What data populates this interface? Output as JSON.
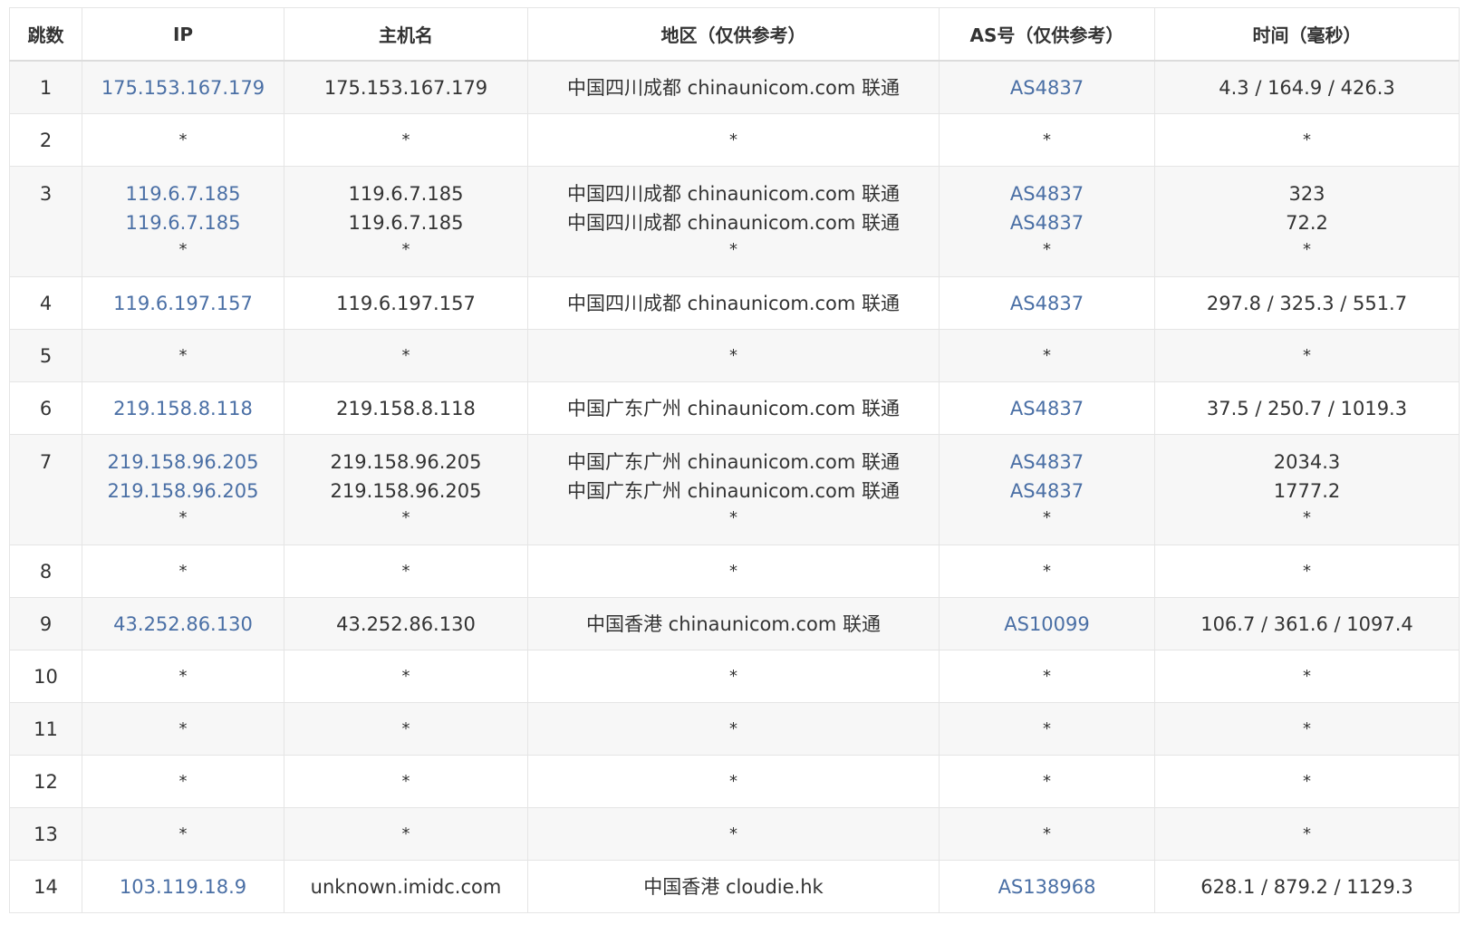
{
  "columns": [
    "跳数",
    "IP",
    "主机名",
    "地区（仅供参考）",
    "AS号（仅供参考）",
    "时间（毫秒）"
  ],
  "rows": [
    {
      "hop": "1",
      "ip": [
        "175.153.167.179"
      ],
      "host": [
        "175.153.167.179"
      ],
      "region": [
        "中国四川成都 chinaunicom.com 联通"
      ],
      "as": [
        "AS4837"
      ],
      "time": [
        "4.3 / 164.9 / 426.3"
      ]
    },
    {
      "hop": "2",
      "ip": [
        "*"
      ],
      "host": [
        "*"
      ],
      "region": [
        "*"
      ],
      "as": [
        "*"
      ],
      "time": [
        "*"
      ]
    },
    {
      "hop": "3",
      "ip": [
        "119.6.7.185",
        "119.6.7.185",
        "*"
      ],
      "host": [
        "119.6.7.185",
        "119.6.7.185",
        "*"
      ],
      "region": [
        "中国四川成都 chinaunicom.com 联通",
        "中国四川成都 chinaunicom.com 联通",
        "*"
      ],
      "as": [
        "AS4837",
        "AS4837",
        "*"
      ],
      "time": [
        "323",
        "72.2",
        "*"
      ]
    },
    {
      "hop": "4",
      "ip": [
        "119.6.197.157"
      ],
      "host": [
        "119.6.197.157"
      ],
      "region": [
        "中国四川成都 chinaunicom.com 联通"
      ],
      "as": [
        "AS4837"
      ],
      "time": [
        "297.8 / 325.3 / 551.7"
      ]
    },
    {
      "hop": "5",
      "ip": [
        "*"
      ],
      "host": [
        "*"
      ],
      "region": [
        "*"
      ],
      "as": [
        "*"
      ],
      "time": [
        "*"
      ]
    },
    {
      "hop": "6",
      "ip": [
        "219.158.8.118"
      ],
      "host": [
        "219.158.8.118"
      ],
      "region": [
        "中国广东广州 chinaunicom.com 联通"
      ],
      "as": [
        "AS4837"
      ],
      "time": [
        "37.5 / 250.7 / 1019.3"
      ]
    },
    {
      "hop": "7",
      "ip": [
        "219.158.96.205",
        "219.158.96.205",
        "*"
      ],
      "host": [
        "219.158.96.205",
        "219.158.96.205",
        "*"
      ],
      "region": [
        "中国广东广州 chinaunicom.com 联通",
        "中国广东广州 chinaunicom.com 联通",
        "*"
      ],
      "as": [
        "AS4837",
        "AS4837",
        "*"
      ],
      "time": [
        "2034.3",
        "1777.2",
        "*"
      ]
    },
    {
      "hop": "8",
      "ip": [
        "*"
      ],
      "host": [
        "*"
      ],
      "region": [
        "*"
      ],
      "as": [
        "*"
      ],
      "time": [
        "*"
      ]
    },
    {
      "hop": "9",
      "ip": [
        "43.252.86.130"
      ],
      "host": [
        "43.252.86.130"
      ],
      "region": [
        "中国香港 chinaunicom.com 联通"
      ],
      "as": [
        "AS10099"
      ],
      "time": [
        "106.7 / 361.6 / 1097.4"
      ]
    },
    {
      "hop": "10",
      "ip": [
        "*"
      ],
      "host": [
        "*"
      ],
      "region": [
        "*"
      ],
      "as": [
        "*"
      ],
      "time": [
        "*"
      ]
    },
    {
      "hop": "11",
      "ip": [
        "*"
      ],
      "host": [
        "*"
      ],
      "region": [
        "*"
      ],
      "as": [
        "*"
      ],
      "time": [
        "*"
      ]
    },
    {
      "hop": "12",
      "ip": [
        "*"
      ],
      "host": [
        "*"
      ],
      "region": [
        "*"
      ],
      "as": [
        "*"
      ],
      "time": [
        "*"
      ]
    },
    {
      "hop": "13",
      "ip": [
        "*"
      ],
      "host": [
        "*"
      ],
      "region": [
        "*"
      ],
      "as": [
        "*"
      ],
      "time": [
        "*"
      ]
    },
    {
      "hop": "14",
      "ip": [
        "103.119.18.9"
      ],
      "host": [
        "unknown.imidc.com"
      ],
      "region": [
        "中国香港 cloudie.hk"
      ],
      "as": [
        "AS138968"
      ],
      "time": [
        "628.1 / 879.2 / 1129.3"
      ]
    }
  ]
}
